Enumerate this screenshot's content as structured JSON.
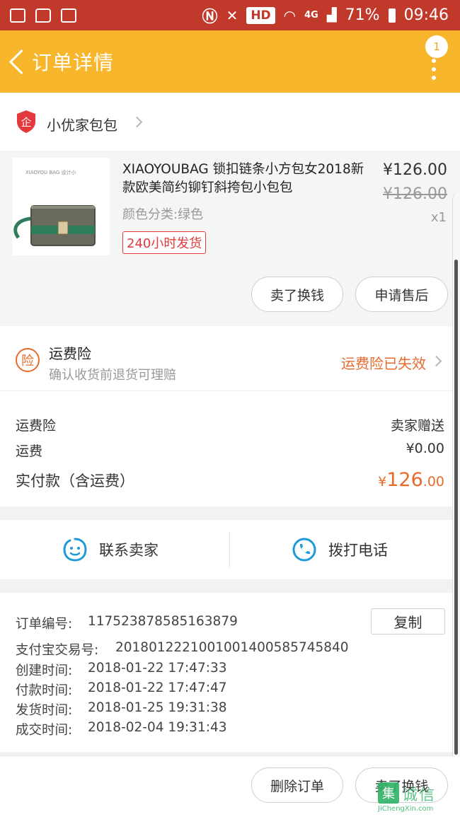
{
  "status_bar": {
    "network": "4G",
    "hd": "HD",
    "battery": "71%",
    "time": "09:46"
  },
  "header": {
    "title": "订单详情",
    "notification_count": "1"
  },
  "shop": {
    "name": "小优家包包"
  },
  "product": {
    "name": "XIAOYOUBAG 锁扣链条小方包女2018新款欧美简约铆钉斜挎包小包包",
    "spec": "颜色分类:绿色",
    "tag": "240小时发货",
    "price": "¥126.00",
    "original_price": "¥126.00",
    "quantity": "x1",
    "thumb_text": "XIAOYOU BAG 设计小",
    "buttons": {
      "sell": "卖了换钱",
      "after_sale": "申请售后"
    }
  },
  "insurance": {
    "icon_char": "险",
    "title": "运费险",
    "subtitle": "确认收货前退货可理赔",
    "status": "运费险已失效"
  },
  "fees": {
    "insurance_label": "运费险",
    "insurance_value": "卖家赠送",
    "shipping_label": "运费",
    "shipping_value": "¥0.00",
    "total_label": "实付款（含运费）",
    "total_currency": "¥",
    "total_integer": "126",
    "total_decimal": ".00"
  },
  "contact": {
    "seller_label": "联系卖家",
    "phone_label": "拨打电话"
  },
  "order_info": {
    "order_no_label": "订单编号:",
    "order_no": "117523878585163879",
    "copy_label": "复制",
    "alipay_label": "支付宝交易号:",
    "alipay_no": "2018012221001001400585745840",
    "created_label": "创建时间:",
    "created": "2018-01-22 17:47:33",
    "paid_label": "付款时间:",
    "paid": "2018-01-22 17:47:47",
    "shipped_label": "发货时间:",
    "shipped": "2018-01-25 19:31:38",
    "completed_label": "成交时间:",
    "completed": "2018-02-04 19:31:43"
  },
  "bottom_bar": {
    "delete_label": "删除订单",
    "sell_label": "卖了换钱"
  },
  "watermark": {
    "char": "集",
    "cn": "诚信",
    "en": "JiChengXin.com"
  },
  "colors": {
    "status_bar": "#c0392b",
    "title_bar": "#f8b62c",
    "accent_orange": "#e86b2c",
    "tag_red": "#e4393c",
    "contact_blue": "#1e9bd7",
    "watermark_green": "#2fb266"
  }
}
